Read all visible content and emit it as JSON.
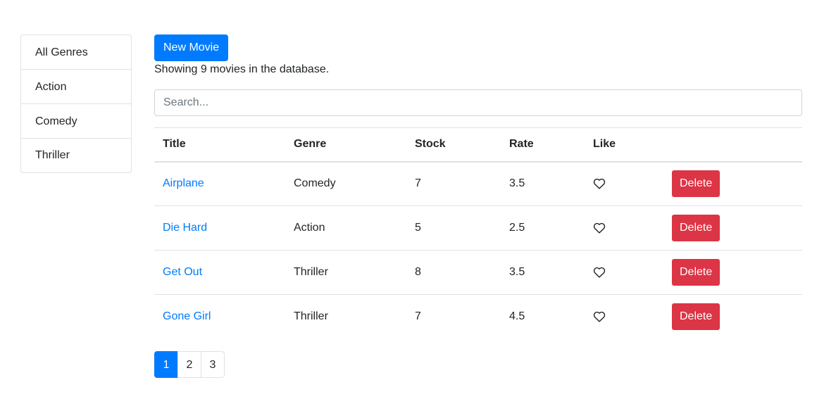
{
  "sidebar": {
    "genres": [
      "All Genres",
      "Action",
      "Comedy",
      "Thriller"
    ]
  },
  "toolbar": {
    "new_movie_label": "New Movie"
  },
  "summary": "Showing 9 movies in the database.",
  "search": {
    "placeholder": "Search...",
    "value": ""
  },
  "table": {
    "headers": [
      "Title",
      "Genre",
      "Stock",
      "Rate",
      "Like",
      ""
    ],
    "rows": [
      {
        "title": "Airplane",
        "genre": "Comedy",
        "stock": "7",
        "rate": "3.5",
        "delete_label": "Delete"
      },
      {
        "title": "Die Hard",
        "genre": "Action",
        "stock": "5",
        "rate": "2.5",
        "delete_label": "Delete"
      },
      {
        "title": "Get Out",
        "genre": "Thriller",
        "stock": "8",
        "rate": "3.5",
        "delete_label": "Delete"
      },
      {
        "title": "Gone Girl",
        "genre": "Thriller",
        "stock": "7",
        "rate": "4.5",
        "delete_label": "Delete"
      }
    ],
    "like_icon": "heart-outline-icon"
  },
  "pagination": {
    "pages": [
      "1",
      "2",
      "3"
    ],
    "active": "1"
  },
  "colors": {
    "primary": "#007bff",
    "danger": "#dc3545"
  }
}
